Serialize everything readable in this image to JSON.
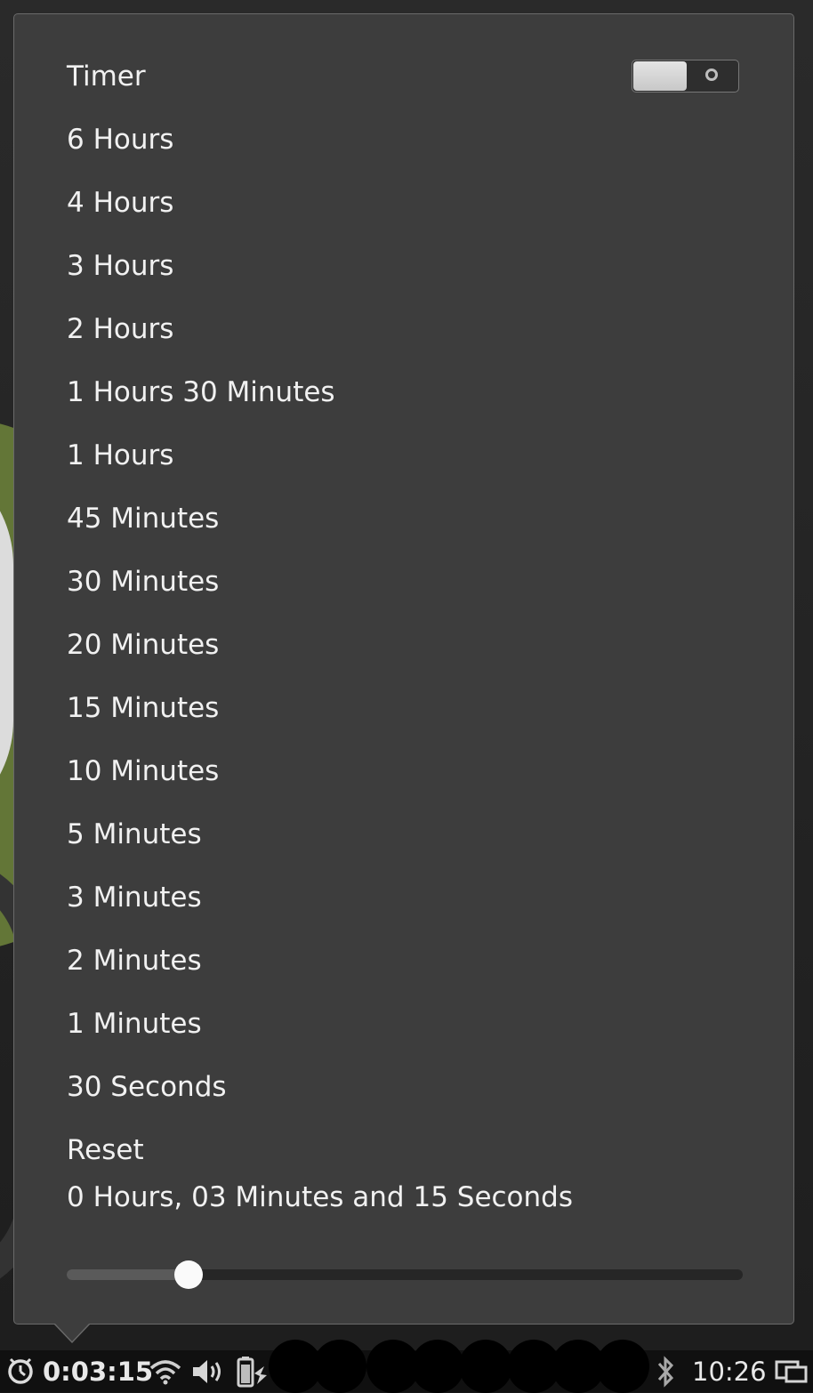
{
  "popup": {
    "timer_label": "Timer",
    "timer_enabled": false,
    "presets": [
      "6 Hours",
      "4 Hours",
      "3 Hours",
      "2 Hours",
      "1 Hours 30 Minutes",
      "1 Hours",
      "45 Minutes",
      "30 Minutes",
      "20 Minutes",
      "15 Minutes",
      "10 Minutes",
      "5 Minutes",
      "3 Minutes",
      "2 Minutes",
      "1 Minutes",
      "30 Seconds",
      "Reset"
    ],
    "remaining_text": "0 Hours, 03 Minutes and 15 Seconds",
    "slider_fraction": 0.18
  },
  "taskbar": {
    "timer_applet_value": "0:03:15",
    "clock": "10:26",
    "icons": [
      "alarm-clock-icon",
      "wifi-icon",
      "volume-icon",
      "battery-icon",
      "bluetooth-icon",
      "show-desktop-icon"
    ]
  }
}
